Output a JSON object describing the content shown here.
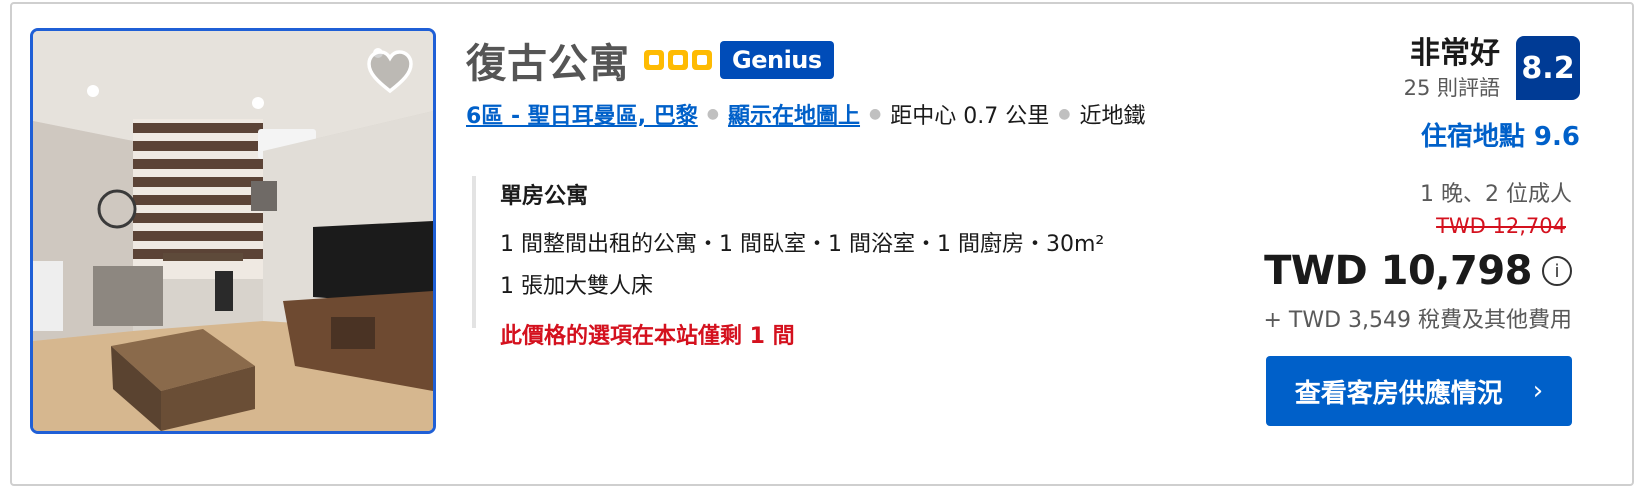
{
  "property": {
    "name": "復古公寓",
    "stars": 3,
    "genius_badge": "Genius",
    "favorite_icon": "heart-icon"
  },
  "location": {
    "district_link": "6區 - 聖日耳曼區, 巴黎",
    "map_link": "顯示在地圖上",
    "distance": "距中心 0.7 公里",
    "transit": "近地鐵"
  },
  "room": {
    "type": "單房公寓",
    "description": "1 間整間出租的公寓・1 間臥室・1 間浴室・1 間廚房・30m²",
    "bed": "1 張加大雙人床",
    "availability_warning": "此價格的選項在本站僅剩 1 間"
  },
  "review": {
    "score_word": "非常好",
    "review_count": "25 則評語",
    "score": "8.2",
    "location_score": "住宿地點 9.6"
  },
  "pricing": {
    "stay_info": "1 晚、2 位成人",
    "original_price": "TWD 12,704",
    "current_price": "TWD 10,798",
    "taxes": "+ TWD 3,549 稅費及其他費用",
    "cta_label": "查看客房供應情況",
    "cta_icon": "chevron-right-icon"
  },
  "colors": {
    "brand_blue": "#0060c9",
    "badge_navy": "#003b95",
    "genius_blue": "#004cb8",
    "star_yellow": "#febb02",
    "alert_red": "#d4111e"
  }
}
